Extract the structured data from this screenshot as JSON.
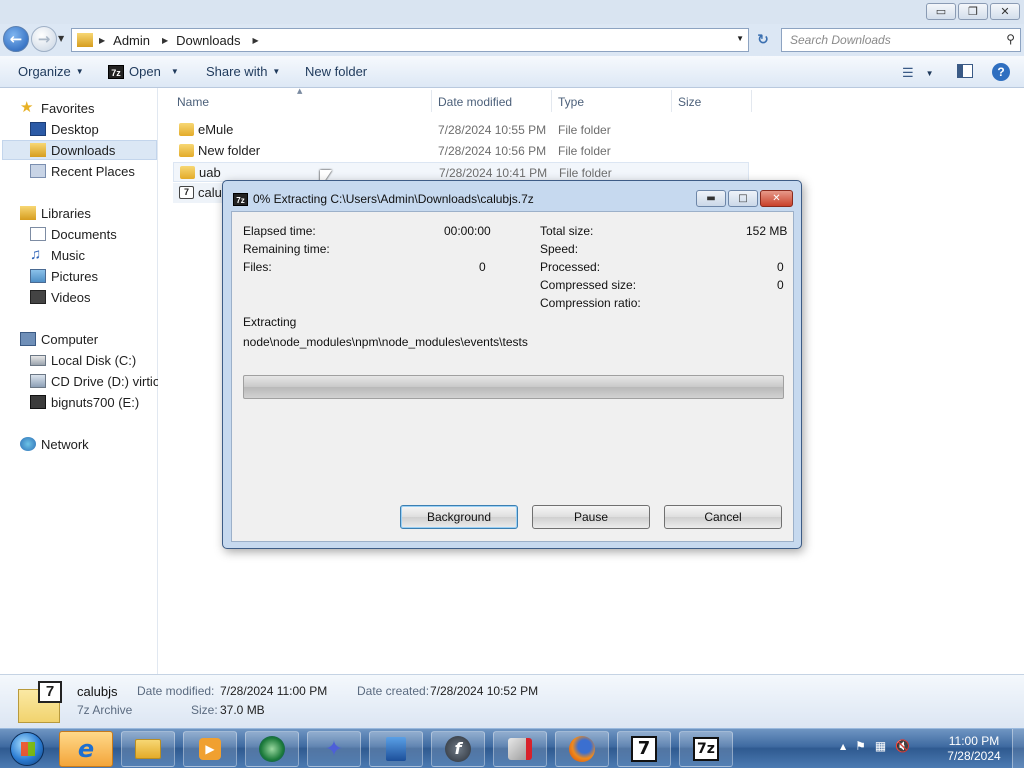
{
  "window": {
    "controls": {
      "minimize": "▭",
      "maximize": "❐",
      "close": "✕"
    }
  },
  "address_bar": {
    "breadcrumbs": [
      "Admin",
      "Downloads"
    ],
    "search_placeholder": "Search Downloads"
  },
  "toolbar": {
    "organize_label": "Organize",
    "open_label": "Open",
    "share_label": "Share with",
    "new_folder_label": "New folder"
  },
  "sidebar": {
    "favorites_label": "Favorites",
    "favorites": [
      "Desktop",
      "Downloads",
      "Recent Places"
    ],
    "libraries_label": "Libraries",
    "libraries": [
      "Documents",
      "Music",
      "Pictures",
      "Videos"
    ],
    "computer_label": "Computer",
    "drives": [
      "Local Disk (C:)",
      "CD Drive (D:) virtio-w",
      "bignuts700 (E:)"
    ],
    "network_label": "Network"
  },
  "file_list": {
    "columns": [
      "Name",
      "Date modified",
      "Type",
      "Size"
    ],
    "rows": [
      {
        "name": "eMule",
        "date": "7/28/2024 10:55 PM",
        "type": "File folder"
      },
      {
        "name": "New folder",
        "date": "7/28/2024 10:56 PM",
        "type": "File folder"
      },
      {
        "name": "uab",
        "date": "7/28/2024 10:41 PM",
        "type": "File folder"
      },
      {
        "name": "calu",
        "date": "",
        "type": ""
      }
    ]
  },
  "dialog": {
    "icon_label": "7z",
    "title": "0% Extracting C:\\Users\\Admin\\Downloads\\calubjs.7z",
    "elapsed_label": "Elapsed time:",
    "elapsed_value": "00:00:00",
    "remaining_label": "Remaining time:",
    "files_label": "Files:",
    "files_value": "0",
    "total_size_label": "Total size:",
    "total_size_value": "152 MB",
    "speed_label": "Speed:",
    "processed_label": "Processed:",
    "processed_value": "0",
    "compressed_label": "Compressed size:",
    "compressed_value": "0",
    "ratio_label": "Compression ratio:",
    "extracting_label": "Extracting",
    "current_path": "node\\node_modules\\npm\\node_modules\\events\\tests",
    "progress_percent": 0,
    "buttons": {
      "background": "Background",
      "pause": "Pause",
      "cancel": "Cancel"
    }
  },
  "details_pane": {
    "file_name": "calubjs",
    "file_type": "7z Archive",
    "modified_label": "Date modified:",
    "modified_value": "7/28/2024 11:00 PM",
    "created_label": "Date created:",
    "created_value": "7/28/2024 10:52 PM",
    "size_label": "Size:",
    "size_value": "37.0 MB"
  },
  "taskbar": {
    "apps": [
      "ie-icon",
      "explorer-icon",
      "media-player-icon",
      "chrome-like-icon",
      "bird-app-icon",
      "network-app-icon",
      "flash-icon",
      "paint-app-icon",
      "firefox-icon",
      "seven-app-icon",
      "7zip-icon"
    ],
    "clock_time": "11:00 PM",
    "clock_date": "7/28/2024"
  }
}
